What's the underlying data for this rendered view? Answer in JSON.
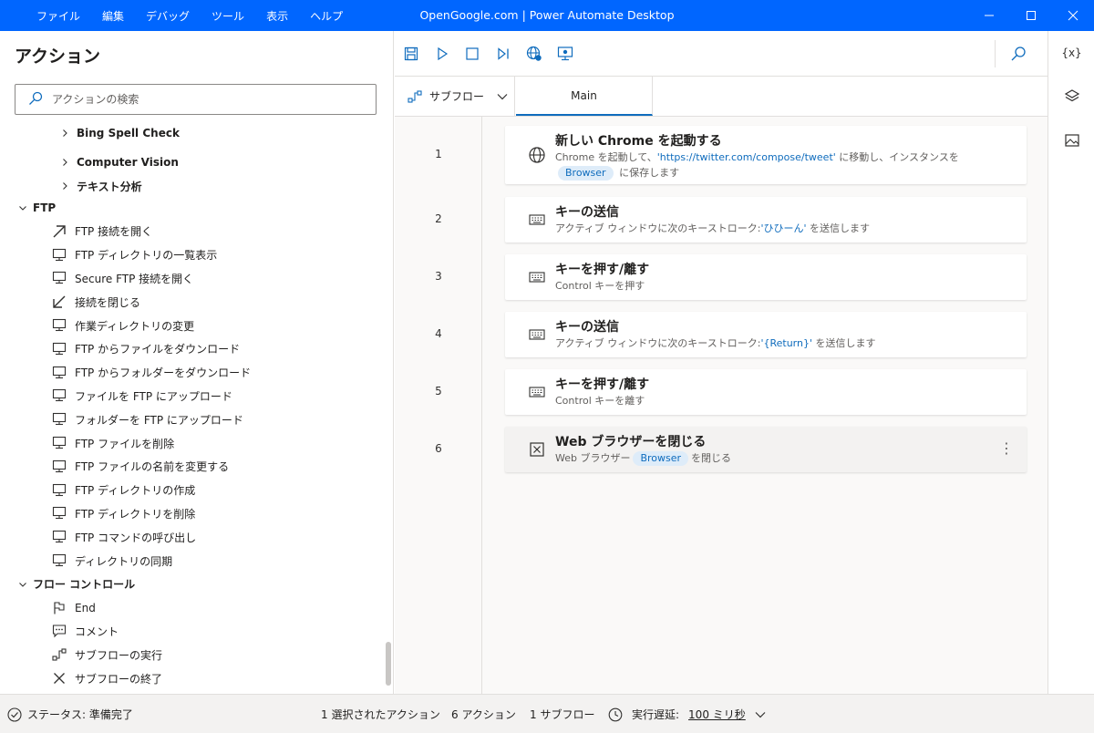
{
  "titlebar": {
    "menu": [
      "ファイル",
      "編集",
      "デバッグ",
      "ツール",
      "表示",
      "ヘルプ"
    ],
    "title": "OpenGoogle.com | Power Automate Desktop"
  },
  "left": {
    "title": "アクション",
    "search_placeholder": "アクションの検索",
    "items": [
      {
        "label": "Bing Spell Check",
        "level": 2,
        "type": "group"
      },
      {
        "label": "Computer Vision",
        "level": 2,
        "type": "group"
      },
      {
        "label": "テキスト分析",
        "level": 2,
        "type": "group"
      },
      {
        "label": "FTP",
        "level": 0,
        "type": "category"
      },
      {
        "label": "FTP 接続を開く",
        "icon": "arrow-up-right-icon"
      },
      {
        "label": "FTP ディレクトリの一覧表示",
        "icon": "monitor-icon"
      },
      {
        "label": "Secure FTP 接続を開く",
        "icon": "monitor-icon"
      },
      {
        "label": "接続を閉じる",
        "icon": "arrow-down-left-icon"
      },
      {
        "label": "作業ディレクトリの変更",
        "icon": "monitor-icon"
      },
      {
        "label": "FTP からファイルをダウンロード",
        "icon": "monitor-icon"
      },
      {
        "label": "FTP からフォルダーをダウンロード",
        "icon": "monitor-icon"
      },
      {
        "label": "ファイルを FTP にアップロード",
        "icon": "monitor-icon"
      },
      {
        "label": "フォルダーを FTP にアップロード",
        "icon": "monitor-icon"
      },
      {
        "label": "FTP ファイルを削除",
        "icon": "monitor-icon"
      },
      {
        "label": "FTP ファイルの名前を変更する",
        "icon": "monitor-icon"
      },
      {
        "label": "FTP ディレクトリの作成",
        "icon": "monitor-icon"
      },
      {
        "label": "FTP ディレクトリを削除",
        "icon": "monitor-icon"
      },
      {
        "label": "FTP コマンドの呼び出し",
        "icon": "monitor-icon"
      },
      {
        "label": "ディレクトリの同期",
        "icon": "monitor-icon"
      },
      {
        "label": "フロー コントロール",
        "level": 0,
        "type": "category"
      },
      {
        "label": "End",
        "icon": "flag-icon"
      },
      {
        "label": "コメント",
        "icon": "comment-icon"
      },
      {
        "label": "サブフローの実行",
        "icon": "subflow-icon"
      },
      {
        "label": "サブフローの終了",
        "icon": "x-icon"
      }
    ]
  },
  "tabs": {
    "subflow_label": "サブフロー",
    "main_label": "Main"
  },
  "actions": [
    {
      "num": "1",
      "title": "新しい Chrome を起動する",
      "icon": "globe-icon",
      "d1": "Chrome を起動して、",
      "link": "'https://twitter.com/compose/tweet'",
      "d2": " に移動し、インスタンスを",
      "pill": "Browser",
      "d3": " に保存します"
    },
    {
      "num": "2",
      "title": "キーの送信",
      "icon": "keyboard-icon",
      "d1": "アクティブ ウィンドウに次のキーストローク:",
      "link": "'ひひーん'",
      "d2": " を送信します"
    },
    {
      "num": "3",
      "title": "キーを押す/離す",
      "icon": "keyboard-icon",
      "d1": "Control キーを押す"
    },
    {
      "num": "4",
      "title": "キーの送信",
      "icon": "keyboard-icon",
      "d1": "アクティブ ウィンドウに次のキーストローク:",
      "link": "'{Return}'",
      "d2": " を送信します"
    },
    {
      "num": "5",
      "title": "キーを押す/離す",
      "icon": "keyboard-icon",
      "d1": "Control キーを離す"
    },
    {
      "num": "6",
      "title": "Web ブラウザーを閉じる",
      "icon": "close-box-icon",
      "d1": "Web ブラウザー",
      "pill": "Browser",
      "d2": "を閉じる",
      "selected": true
    }
  ],
  "rail": {
    "variables_label": "{x}"
  },
  "status": {
    "state": "ステータス: 準備完了",
    "selected": "1 選択されたアクション",
    "actions_count": "6 アクション",
    "subflows_count": "1 サブフロー",
    "delay_label": "実行遅延:",
    "delay_value": "100 ミリ秒"
  },
  "colors": {
    "titlebar": "#0066ff",
    "accent": "#0f6cbd"
  }
}
